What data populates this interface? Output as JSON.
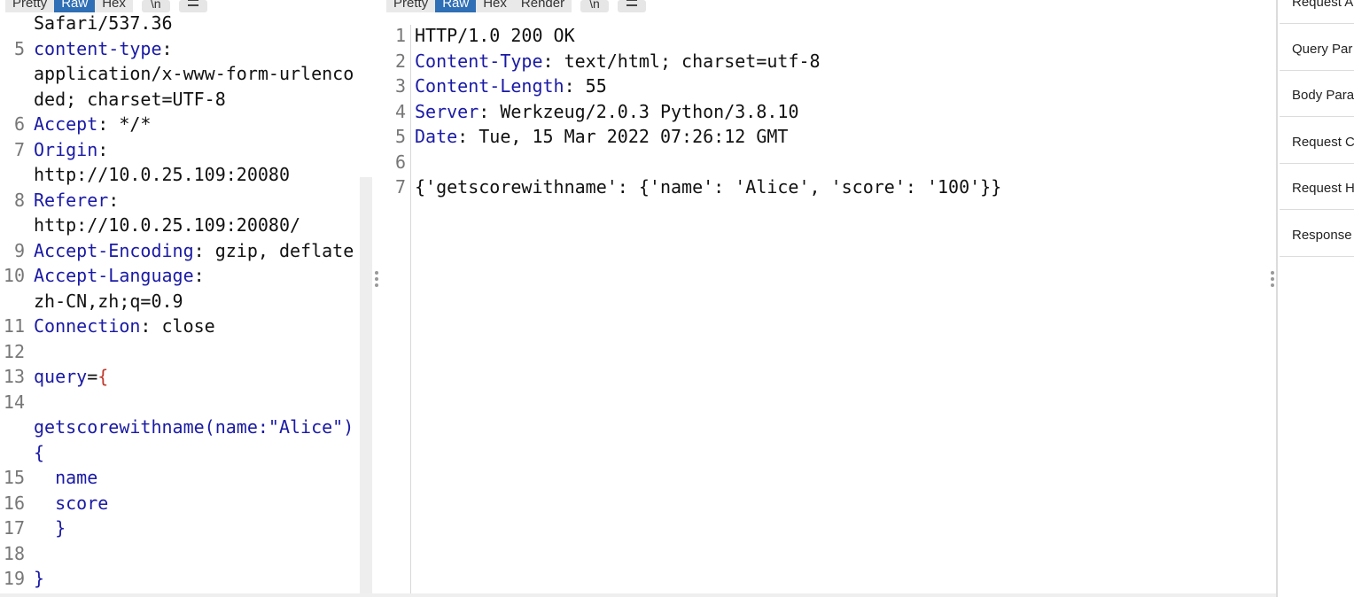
{
  "request_toolbar": {
    "tabs": [
      "Pretty",
      "Raw",
      "Hex"
    ],
    "active_tab": "Raw",
    "newline_button": "\\n",
    "menu_icon": "hamburger-menu-icon"
  },
  "response_toolbar": {
    "tabs": [
      "Pretty",
      "Raw",
      "Hex",
      "Render"
    ],
    "active_tab": "Raw",
    "newline_button": "\\n",
    "menu_icon": "hamburger-menu-icon"
  },
  "request_lines": [
    {
      "num": "",
      "text": "Safari/537.36"
    },
    {
      "num": "5",
      "key": "content-type",
      "sep": ":"
    },
    {
      "num": "",
      "text": "application/x-www-form-urlenco"
    },
    {
      "num": "",
      "text": "ded; charset=UTF-8"
    },
    {
      "num": "6",
      "key": "Accept",
      "sep": ": */*"
    },
    {
      "num": "7",
      "key": "Origin",
      "sep": ":"
    },
    {
      "num": "",
      "text": "http://10.0.25.109:20080"
    },
    {
      "num": "8",
      "key": "Referer",
      "sep": ":"
    },
    {
      "num": "",
      "text": "http://10.0.25.109:20080/"
    },
    {
      "num": "9",
      "key": "Accept-Encoding",
      "sep": ": gzip, deflate"
    },
    {
      "num": "10",
      "key": "Accept-Language",
      "sep": ":"
    },
    {
      "num": "",
      "text": "zh-CN,zh;q=0.9"
    },
    {
      "num": "11",
      "key": "Connection",
      "sep": ": close"
    },
    {
      "num": "12",
      "text": ""
    },
    {
      "num": "13",
      "key": "query",
      "sep": "=",
      "brace": "{"
    },
    {
      "num": "14",
      "text": ""
    },
    {
      "num": "",
      "key": "getscorewithname(name:\"Alice\")"
    },
    {
      "num": "",
      "key": "{"
    },
    {
      "num": "15",
      "key": "  name"
    },
    {
      "num": "16",
      "key": "  score"
    },
    {
      "num": "17",
      "key": "  }"
    },
    {
      "num": "18",
      "text": ""
    },
    {
      "num": "19",
      "key": "}"
    }
  ],
  "response_lines": [
    {
      "num": "1",
      "text": "HTTP/1.0 200 OK"
    },
    {
      "num": "2",
      "key": "Content-Type",
      "sep": ": text/html; charset=utf-8"
    },
    {
      "num": "3",
      "key": "Content-Length",
      "sep": ": 55"
    },
    {
      "num": "4",
      "key": "Server",
      "sep": ": Werkzeug/2.0.3 Python/3.8.10"
    },
    {
      "num": "5",
      "key": "Date",
      "sep": ": Tue, 15 Mar 2022 07:26:12 GMT"
    },
    {
      "num": "6",
      "text": ""
    },
    {
      "num": "7",
      "text": "{'getscorewithname': {'name': 'Alice', 'score': '100'}}"
    }
  ],
  "inspector": {
    "items": [
      "Request A",
      "Query Par",
      "Body Para",
      "Request C",
      "Request H",
      "Response"
    ]
  },
  "colors": {
    "active_tab": "#2f6fb5",
    "header_key": "#1a1aa6",
    "brace": "#c0392b",
    "line_highlight": "#e6e6e6"
  }
}
